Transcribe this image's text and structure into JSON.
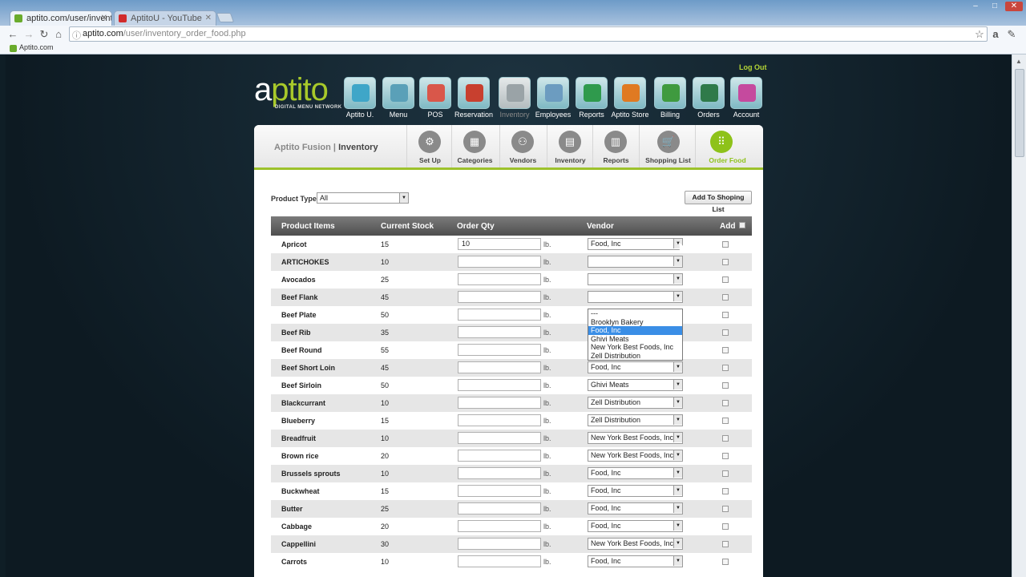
{
  "browser": {
    "tabs": [
      {
        "title": "aptito.com/user/inventory_",
        "active": true,
        "fav_color": "#6aab2c"
      },
      {
        "title": "AptitoU - YouTube",
        "active": false,
        "fav_color": "#d12b2b"
      }
    ],
    "url_domain": "aptito.com",
    "url_path": "/user/inventory_order_food.php",
    "bookmark": "Aptito.com",
    "win_controls": [
      "–",
      "□",
      "✕"
    ]
  },
  "header": {
    "logout": "Log Out",
    "logo_a": "a",
    "logo_p": "ptito",
    "logo_sub": "DIGITAL MENU NETWORK"
  },
  "top_nav": [
    {
      "label": "Aptito U.",
      "color": "#3fa6c8",
      "dim": false
    },
    {
      "label": "Menu",
      "color": "#5aa0b8",
      "dim": false
    },
    {
      "label": "POS",
      "color": "#d9574a",
      "dim": false
    },
    {
      "label": "Reservation",
      "color": "#c8402f",
      "dim": false
    },
    {
      "label": "Inventory",
      "color": "#9aa3a7",
      "dim": true
    },
    {
      "label": "Employees",
      "color": "#6c9cc0",
      "dim": false
    },
    {
      "label": "Reports",
      "color": "#2f9a4d",
      "dim": false
    },
    {
      "label": "Aptito Store",
      "color": "#e07a22",
      "dim": false
    },
    {
      "label": "Billing",
      "color": "#3f9a3f",
      "dim": false
    },
    {
      "label": "Orders",
      "color": "#2f7a4a",
      "dim": false
    },
    {
      "label": "Account",
      "color": "#c54a9e",
      "dim": false
    }
  ],
  "subheader": {
    "title_prefix": "Aptito Fusion | ",
    "title_main": "Inventory",
    "tabs": [
      {
        "label": "Set Up",
        "glyph": "⚙",
        "active": false
      },
      {
        "label": "Categories",
        "glyph": "▦",
        "active": false
      },
      {
        "label": "Vendors",
        "glyph": "⚇",
        "active": false
      },
      {
        "label": "Inventory",
        "glyph": "▤",
        "active": false
      },
      {
        "label": "Reports",
        "glyph": "▥",
        "active": false
      },
      {
        "label": "Shopping List",
        "glyph": "🛒",
        "active": false
      },
      {
        "label": "Order Food",
        "glyph": "⠿",
        "active": true
      }
    ]
  },
  "filters": {
    "product_type_label": "Product Type",
    "product_type_value": "All",
    "add_button": "Add To Shoping List"
  },
  "table": {
    "headers": {
      "items": "Product Items",
      "stock": "Current Stock",
      "qty": "Order Qty",
      "vendor": "Vendor",
      "add": "Add"
    },
    "rows": [
      {
        "name": "Apricot",
        "stock": "15",
        "qty": "10",
        "unit": "lb.",
        "vendor": "Food, Inc"
      },
      {
        "name": "ARTICHOKES",
        "stock": "10",
        "qty": "",
        "unit": "lb.",
        "vendor": ""
      },
      {
        "name": "Avocados",
        "stock": "25",
        "qty": "",
        "unit": "lb.",
        "vendor": ""
      },
      {
        "name": "Beef Flank",
        "stock": "45",
        "qty": "",
        "unit": "lb.",
        "vendor": ""
      },
      {
        "name": "Beef Plate",
        "stock": "50",
        "qty": "",
        "unit": "lb.",
        "vendor": "Food, Inc"
      },
      {
        "name": "Beef Rib",
        "stock": "35",
        "qty": "",
        "unit": "lb.",
        "vendor": "Food, Inc"
      },
      {
        "name": "Beef Round",
        "stock": "55",
        "qty": "",
        "unit": "lb.",
        "vendor": "Food, Inc"
      },
      {
        "name": "Beef Short Loin",
        "stock": "45",
        "qty": "",
        "unit": "lb.",
        "vendor": "Food, Inc"
      },
      {
        "name": "Beef Sirloin",
        "stock": "50",
        "qty": "",
        "unit": "lb.",
        "vendor": "Ghivi Meats"
      },
      {
        "name": "Blackcurrant",
        "stock": "10",
        "qty": "",
        "unit": "lb.",
        "vendor": "Zell Distribution"
      },
      {
        "name": "Blueberry",
        "stock": "15",
        "qty": "",
        "unit": "lb.",
        "vendor": "Zell Distribution"
      },
      {
        "name": "Breadfruit",
        "stock": "10",
        "qty": "",
        "unit": "lb.",
        "vendor": "New York Best Foods, Inc"
      },
      {
        "name": "Brown rice",
        "stock": "20",
        "qty": "",
        "unit": "lb.",
        "vendor": "New York Best Foods, Inc"
      },
      {
        "name": "Brussels sprouts",
        "stock": "10",
        "qty": "",
        "unit": "lb.",
        "vendor": "Food, Inc"
      },
      {
        "name": "Buckwheat",
        "stock": "15",
        "qty": "",
        "unit": "lb.",
        "vendor": "Food, Inc"
      },
      {
        "name": "Butter",
        "stock": "25",
        "qty": "",
        "unit": "lb.",
        "vendor": "Food, Inc"
      },
      {
        "name": "Cabbage",
        "stock": "20",
        "qty": "",
        "unit": "lb.",
        "vendor": "Food, Inc"
      },
      {
        "name": "Cappellini",
        "stock": "30",
        "qty": "",
        "unit": "lb.",
        "vendor": "New York Best Foods, Inc"
      },
      {
        "name": "Carrots",
        "stock": "10",
        "qty": "",
        "unit": "lb.",
        "vendor": "Food, Inc"
      }
    ]
  },
  "vendor_dropdown": {
    "options": [
      "---",
      "Brooklyn Bakery",
      "Food, Inc",
      "Ghivi Meats",
      "New York Best Foods, Inc",
      "Zell Distribution"
    ],
    "selected": "Food, Inc"
  }
}
